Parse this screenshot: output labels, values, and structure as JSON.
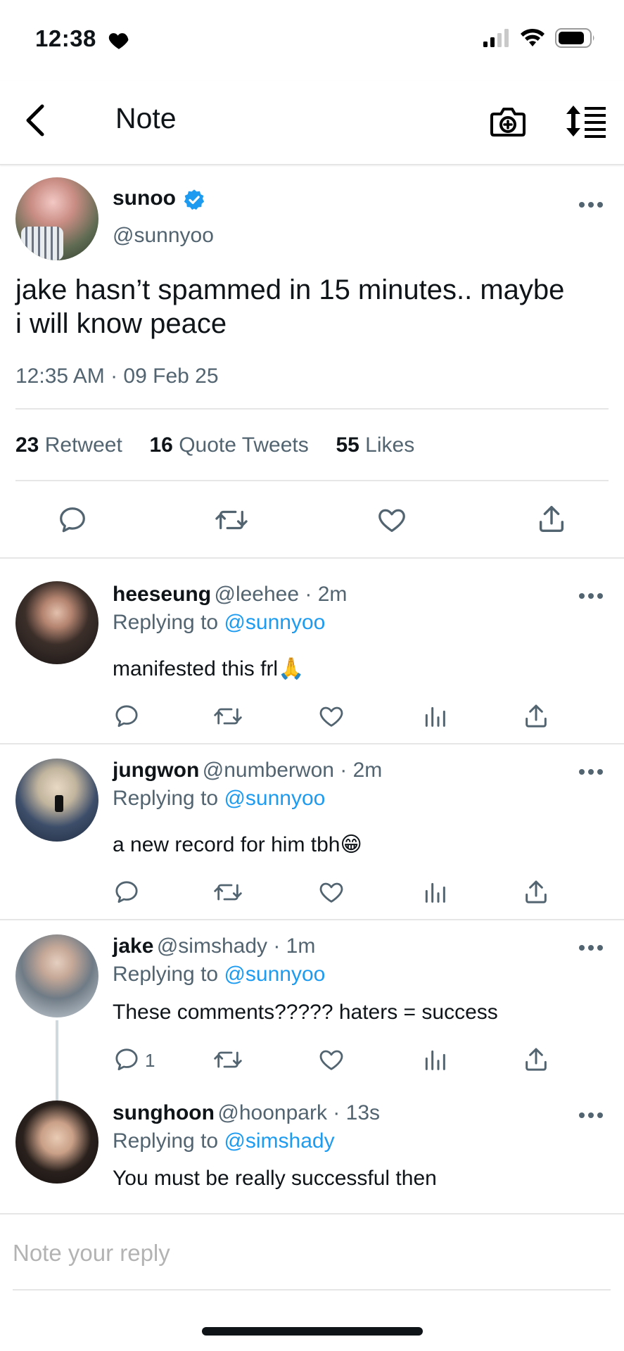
{
  "status_bar": {
    "time": "12:38"
  },
  "nav": {
    "title": "Note"
  },
  "main_tweet": {
    "name": "sunoo",
    "handle": "@sunnyoo",
    "text_line1": "jake hasn’t spammed in 15 minutes.. maybe",
    "text_line2": "i will know peace",
    "timestamp": "12:35 AM · 09 Feb 25",
    "stats": {
      "retweets": "23",
      "retweets_label": "Retweet",
      "quotes": "16",
      "quotes_label": "Quote Tweets",
      "likes": "55",
      "likes_label": "Likes"
    }
  },
  "replies": [
    {
      "name": "heeseung",
      "meta": "@leehee · 2m",
      "replying_prefix": "Replying to ",
      "replying_to": "@sunnyoo",
      "text": "manifested this frl🙏"
    },
    {
      "name": "jungwon",
      "meta": "@numberwon · 2m",
      "replying_prefix": "Replying to ",
      "replying_to": "@sunnyoo",
      "text": "a new record for him tbh😁"
    },
    {
      "name": "jake",
      "meta": "@simshady · 1m",
      "replying_prefix": "Replying to ",
      "replying_to": "@sunnyoo",
      "text": "These comments????? haters = success",
      "reply_count": "1"
    },
    {
      "name": "sunghoon",
      "meta": "@hoonpark · 13s",
      "replying_prefix": "Replying to ",
      "replying_to": "@simshady",
      "text": "You must be really successful then"
    }
  ],
  "composer": {
    "placeholder": "Note your reply"
  },
  "colors": {
    "accent": "#1d9bf0",
    "verified": "#1d9bf0",
    "text": "#0f1419",
    "secondary": "#536471"
  }
}
